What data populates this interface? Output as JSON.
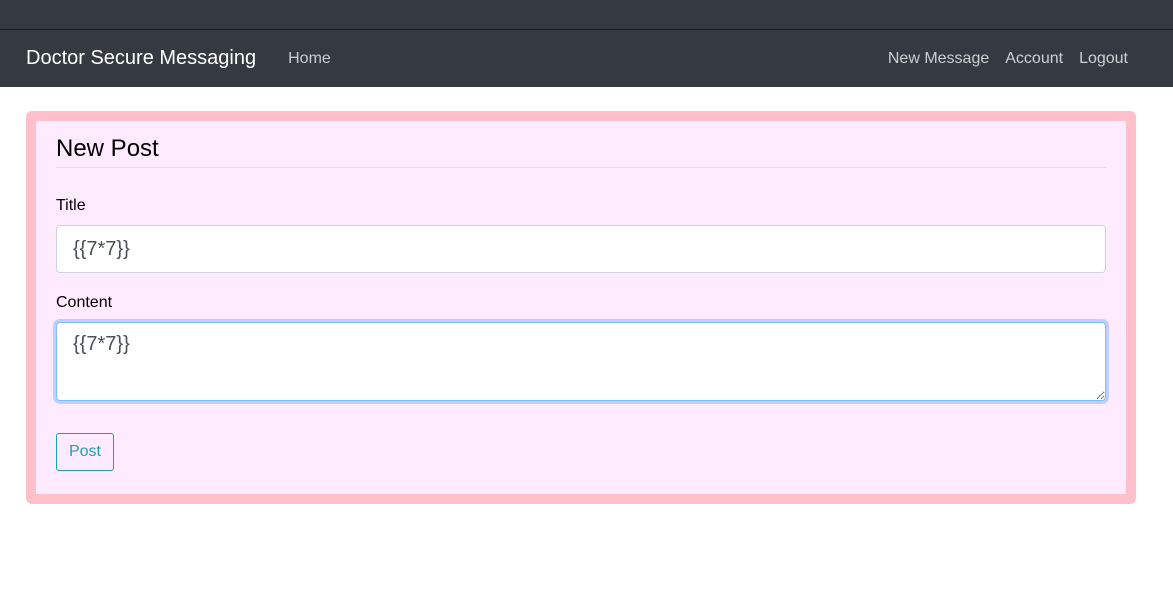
{
  "navbar": {
    "brand": "Doctor Secure Messaging",
    "left_links": [
      {
        "label": "Home"
      }
    ],
    "right_links": [
      {
        "label": "New Message"
      },
      {
        "label": "Account"
      },
      {
        "label": "Logout"
      }
    ]
  },
  "form": {
    "legend": "New Post",
    "title_label": "Title",
    "title_value": "{{7*7}}",
    "content_label": "Content",
    "content_value": "{{7*7}}",
    "submit_label": "Post"
  },
  "colors": {
    "navbar_bg": "#343a40",
    "panel_border": "#ffc0cb",
    "panel_bg": "#ffebff",
    "button_accent": "#17a2b8"
  }
}
